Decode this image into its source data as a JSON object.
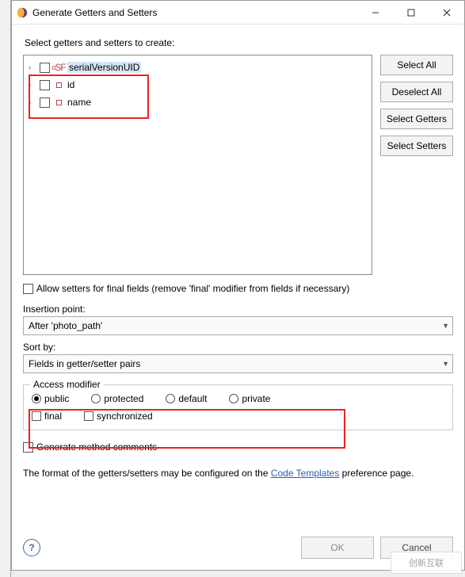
{
  "window": {
    "title": "Generate Getters and Setters"
  },
  "instruction": "Select getters and setters to create:",
  "tree": {
    "items": [
      {
        "label": "serialVersionUID",
        "icon": "SF",
        "selected": true
      },
      {
        "label": "id",
        "icon": "sq"
      },
      {
        "label": "name",
        "icon": "sq"
      }
    ]
  },
  "side_buttons": {
    "select_all": "Select All",
    "deselect_all": "Deselect All",
    "select_getters": "Select Getters",
    "select_setters": "Select Setters"
  },
  "allow_final": "Allow setters for final fields (remove 'final' modifier from fields if necessary)",
  "insertion_label": "Insertion point:",
  "insertion_value": "After 'photo_path'",
  "sort_label": "Sort by:",
  "sort_value": "Fields in getter/setter pairs",
  "access_group": "Access modifier",
  "radios": {
    "public": "public",
    "protected": "protected",
    "default": "default",
    "private": "private"
  },
  "mods": {
    "final": "final",
    "synchronized": "synchronized"
  },
  "gen_comments": "Generate method comments",
  "note_pre": "The format of the getters/setters may be configured on the ",
  "note_link": "Code Templates",
  "note_post": " preference page.",
  "ok": "OK",
  "cancel": "Cancel",
  "watermark": "创新互联"
}
